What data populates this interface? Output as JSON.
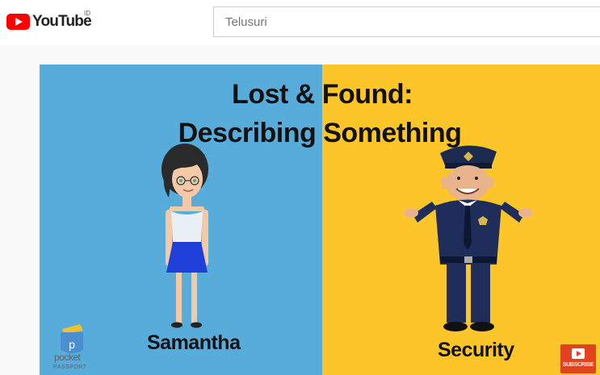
{
  "header": {
    "logo_text": "YouTube",
    "country_code": "ID",
    "search_placeholder": "Telusuri"
  },
  "video": {
    "title_line1": "Lost & Found:",
    "title_line2": "Describing Something",
    "character_left_name": "Samantha",
    "character_right_name": "Security",
    "brand_name": "pocket",
    "brand_sub": "PASSPORT",
    "subscribe_label": "SUBSCRIBE"
  },
  "colors": {
    "youtube_red": "#ff0000",
    "left_background": "#57acd9",
    "right_background": "#fcc52a",
    "subscribe_orange": "#e1431f"
  },
  "icons": [
    "youtube-play-icon",
    "pocket-passport-icon",
    "subscribe-play-icon"
  ]
}
